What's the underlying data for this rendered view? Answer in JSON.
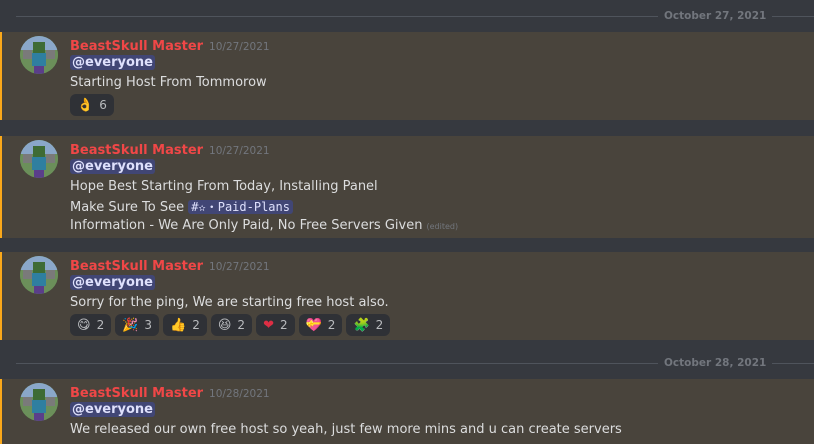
{
  "dates": [
    "October 27, 2021",
    "October 28, 2021"
  ],
  "messages": [
    {
      "username": "BeastSkull Master",
      "timestamp": "10/27/2021",
      "mention": "@everyone",
      "lines": [
        "Starting Host From Tommorow"
      ],
      "reactions": [
        {
          "emoji": "👌",
          "icon": "ok-hand-emoji-icon",
          "count": "6"
        }
      ]
    },
    {
      "username": "BeastSkull Master",
      "timestamp": "10/27/2021",
      "mention": "@everyone",
      "lines": [
        "Hope Best Starting From Today, Installing Panel",
        "Make Sure To See",
        "Information - We Are Only Paid, No Free Servers Given"
      ],
      "channel": "#✫・Paid-Plans",
      "edited": "(edited)"
    },
    {
      "username": "BeastSkull Master",
      "timestamp": "10/27/2021",
      "mention": "@everyone",
      "lines": [
        "Sorry for the ping, We are starting free host also."
      ],
      "reactions": [
        {
          "emoji": "😋",
          "icon": "yum-emoji-icon",
          "count": "2"
        },
        {
          "emoji": "🎉",
          "icon": "tada-emoji-icon",
          "count": "3"
        },
        {
          "emoji": "👍",
          "icon": "thumbs-up-emoji-icon",
          "count": "2"
        },
        {
          "emoji": "😆",
          "icon": "laughing-emoji-icon",
          "count": "2"
        },
        {
          "emoji": "❤",
          "icon": "heart-emoji-icon",
          "count": "2"
        },
        {
          "emoji": "💝",
          "icon": "gift-heart-emoji-icon",
          "count": "2"
        },
        {
          "emoji": "🧩",
          "icon": "custom-green-emoji-icon",
          "count": "2"
        }
      ]
    },
    {
      "username": "BeastSkull Master",
      "timestamp": "10/28/2021",
      "mention": "@everyone",
      "lines": [
        "We released our own free host so yeah, just few more mins and u can create servers"
      ]
    }
  ]
}
